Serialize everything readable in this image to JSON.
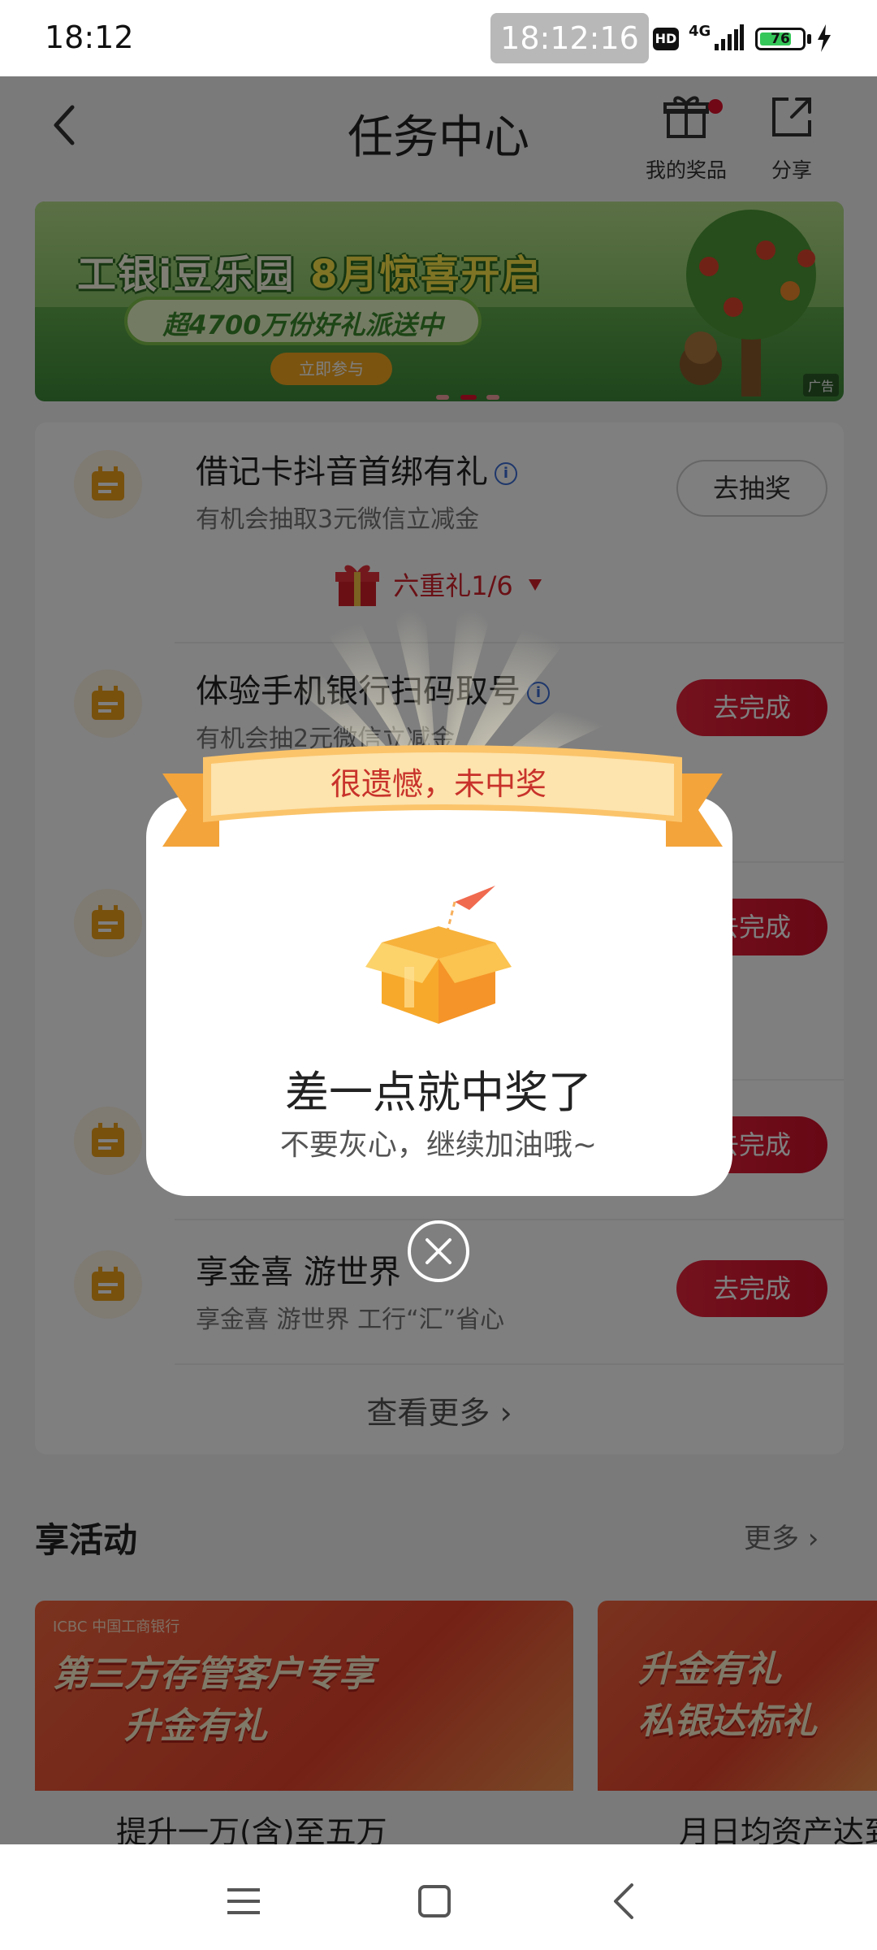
{
  "status_bar": {
    "time": "18:12",
    "clock_pill": "18:12:16",
    "hd": "HD",
    "network": "4G",
    "battery": "76",
    "battery_fill": 0.76,
    "battery_color": "#35c759"
  },
  "header": {
    "title": "任务中心",
    "my_prizes_label": "我的奖品",
    "share_label": "分享"
  },
  "banner": {
    "title_part1": "工银i豆乐园 ",
    "title_part2": "8月惊喜开启",
    "subtitle": "超4700万份好礼派送中",
    "cta": "立即参与",
    "ad_tag": "广告"
  },
  "tasks": [
    {
      "title": "借记卡抖音首绑有礼",
      "subtitle": "有机会抽取3元微信立减金",
      "button": "去抽奖",
      "button_style": "outline"
    },
    {
      "title": "体验手机银行扫码取号",
      "subtitle": "有机会抽2元微信立减金",
      "button": "去完成",
      "button_style": "red"
    },
    {
      "title": "",
      "subtitle": "",
      "button": "去完成",
      "button_style": "red"
    },
    {
      "title": "",
      "subtitle": "",
      "button": "去完成",
      "button_style": "red"
    },
    {
      "title": "享金喜 游世界",
      "subtitle": "享金喜 游世界 工行“汇”省心",
      "button": "去完成",
      "button_style": "red"
    }
  ],
  "tier": {
    "label": "六重礼1/6"
  },
  "view_more": "查看更多 ›",
  "activities": {
    "title": "享活动",
    "more": "更多 ›",
    "cards": [
      {
        "header": "ICBC 中国工商银行",
        "big1": "第三方存管客户专享",
        "big2": "升金有礼",
        "desc": "提升一万(含)至五万"
      },
      {
        "header": "",
        "big1": "升金有礼",
        "big2": "私银达标礼",
        "desc": "月日均资产达到"
      }
    ]
  },
  "dialog": {
    "ribbon": "很遗憾，未中奖",
    "title": "差一点就中奖了",
    "subtitle": "不要灰心，继续加油哦~"
  },
  "colors": {
    "brand_red": "#d00f2a",
    "ribbon_orange": "#f6b44f",
    "overlay": "rgba(0,0,0,0.5)"
  }
}
